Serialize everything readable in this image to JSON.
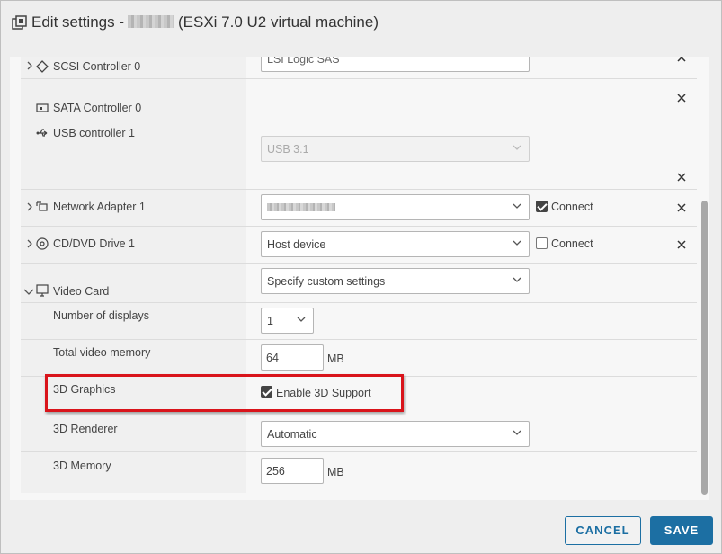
{
  "window": {
    "title_prefix": "Edit settings -",
    "title_suffix": "(ESXi 7.0 U2 virtual machine)",
    "title_icon": "vm-settings-icon"
  },
  "devices": {
    "scsi": {
      "label": "SCSI Controller 0",
      "value": "LSI Logic SAS",
      "icon": "scsi-controller-icon"
    },
    "sata": {
      "label": "SATA Controller 0",
      "icon": "sata-controller-icon"
    },
    "usb": {
      "label": "USB controller 1",
      "value": "USB 3.1",
      "icon": "usb-icon"
    },
    "network": {
      "label": "Network Adapter 1",
      "connect_label": "Connect",
      "connected": true,
      "icon": "network-adapter-icon"
    },
    "cdrom": {
      "label": "CD/DVD Drive 1",
      "value": "Host device",
      "connect_label": "Connect",
      "connected": false,
      "icon": "cd-dvd-icon"
    },
    "video": {
      "label": "Video Card",
      "value": "Specify custom settings",
      "icon": "monitor-icon",
      "displays": {
        "label": "Number of displays",
        "value": "1"
      },
      "memory": {
        "label": "Total video memory",
        "value": "64",
        "unit": "MB"
      },
      "graphics3d": {
        "label": "3D Graphics",
        "checkbox_label": "Enable 3D Support",
        "enabled": true
      },
      "renderer": {
        "label": "3D Renderer",
        "value": "Automatic"
      },
      "memory3d": {
        "label": "3D Memory",
        "value": "256",
        "unit": "MB"
      }
    }
  },
  "footer": {
    "cancel_label": "CANCEL",
    "save_label": "SAVE"
  },
  "colors": {
    "accent": "#1c6fa3",
    "highlight": "#d9141b"
  }
}
